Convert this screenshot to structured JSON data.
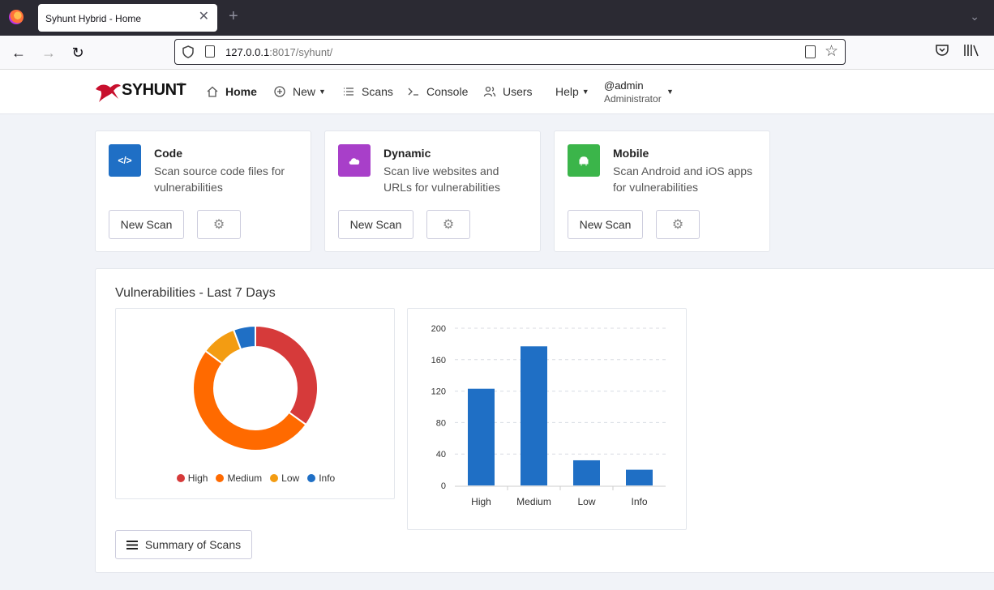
{
  "browser": {
    "tab_title": "Syhunt Hybrid - Home",
    "url_host": "127.0.0.1",
    "url_rest": ":8017/syhunt/"
  },
  "header": {
    "logo_text": "SYHUNT",
    "logo_mark": "®",
    "menu": [
      {
        "label": "Home",
        "icon": "home-icon"
      },
      {
        "label": "New",
        "icon": "plus-circle-icon"
      },
      {
        "label": "Scans",
        "icon": "list-icon"
      },
      {
        "label": "Console",
        "icon": "terminal-icon"
      },
      {
        "label": "Users",
        "icon": "users-icon"
      },
      {
        "label": "Help",
        "icon": ""
      }
    ],
    "user_name": "@admin",
    "user_role": "Administrator"
  },
  "cards": [
    {
      "title": "Code",
      "desc": "Scan source code files for vulnerabilities",
      "icon": "code-icon",
      "glyph": "</>",
      "color": "#1f6fc5",
      "new_label": "New Scan"
    },
    {
      "title": "Dynamic",
      "desc": "Scan live websites and URLs for vulnerabilities",
      "icon": "cloud-icon",
      "glyph": "",
      "color": "#a83fc9",
      "new_label": "New Scan"
    },
    {
      "title": "Mobile",
      "desc": "Scan Android and iOS apps for vulnerabilities",
      "icon": "android-icon",
      "glyph": "",
      "color": "#3bb54a",
      "new_label": "New Scan"
    }
  ],
  "vulns": {
    "title": "Vulnerabilities - Last 7 Days",
    "summary_label": "Summary of Scans"
  },
  "chart_data": [
    {
      "type": "pie",
      "categories": [
        "High",
        "Medium",
        "Low",
        "Info"
      ],
      "values": [
        123,
        177,
        32,
        20
      ],
      "colors": [
        "#d63a3a",
        "#ff6a00",
        "#f39c12",
        "#1f6fc5"
      ],
      "legend": "bottom"
    },
    {
      "type": "bar",
      "categories": [
        "High",
        "Medium",
        "Low",
        "Info"
      ],
      "values": [
        123,
        177,
        32,
        20
      ],
      "color": "#1f6fc5",
      "ylim": [
        0,
        200
      ],
      "yticks": [
        0,
        40,
        80,
        120,
        160,
        200
      ],
      "grid": true
    }
  ]
}
